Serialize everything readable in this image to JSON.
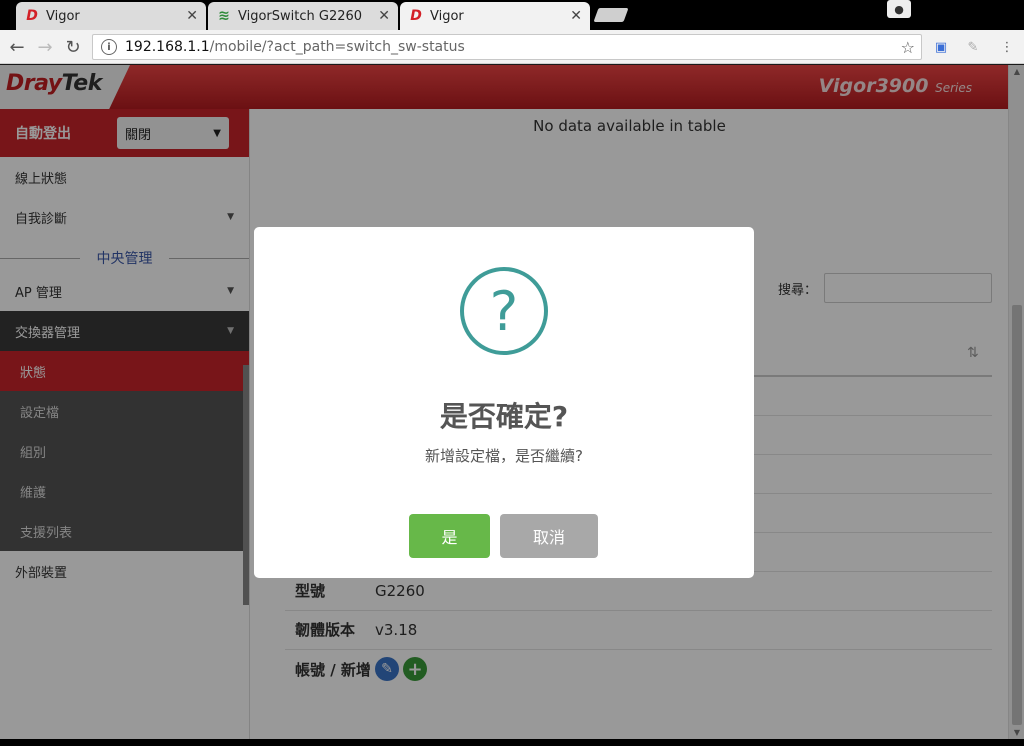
{
  "browser": {
    "tabs": [
      {
        "title": "Vigor",
        "icon": "draytek-icon",
        "active": false
      },
      {
        "title": "VigorSwitch G2260",
        "icon": "rss-icon",
        "active": false
      },
      {
        "title": "Vigor",
        "icon": "draytek-icon",
        "active": true
      }
    ],
    "close_glyph": "✕",
    "url_host": "192.168.1.1",
    "url_path": "/mobile/?act_path=switch_sw-status"
  },
  "header": {
    "logo_brand": "Dray",
    "logo_brand_2": "Tek",
    "model": "Vigor3900",
    "model_suffix": "Series"
  },
  "sidebar": {
    "auto_logout_label": "自動登出",
    "auto_logout_value": "關閉",
    "items_top": [
      {
        "label": "線上狀態"
      },
      {
        "label": "自我診斷"
      }
    ],
    "section_title": "中央管理",
    "ap_label": "AP 管理",
    "switch_label": "交換器管理",
    "sub_items": [
      {
        "label": "狀態",
        "active": true
      },
      {
        "label": "設定檔"
      },
      {
        "label": "組別"
      },
      {
        "label": "維護"
      },
      {
        "label": "支援列表"
      }
    ],
    "external_label": "外部裝置"
  },
  "main": {
    "no_data": "No data available in table",
    "search_label": "搜尋：",
    "search_value": "",
    "model_key": "型號",
    "model_value": "G2260",
    "firmware_key": "韌體版本",
    "firmware_value": "v3.18",
    "account_key": "帳號 / 新增"
  },
  "dialog": {
    "icon": "?",
    "title": "是否確定?",
    "message": "新增設定檔，是否繼續?",
    "confirm_label": "是",
    "cancel_label": "取消"
  },
  "colors": {
    "brand_red": "#c8232a",
    "confirm_green": "#67b849",
    "cancel_gray": "#a8a8a8",
    "question_teal": "#3f9c98"
  }
}
